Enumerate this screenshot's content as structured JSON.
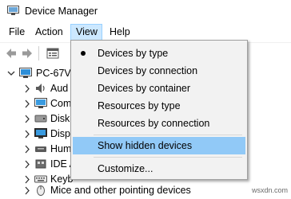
{
  "window": {
    "title": "Device Manager",
    "icon": "device-manager-icon"
  },
  "menubar": {
    "items": [
      {
        "label": "File"
      },
      {
        "label": "Action"
      },
      {
        "label": "View"
      },
      {
        "label": "Help"
      }
    ],
    "active": "View"
  },
  "toolbar": {
    "buttons": [
      "back-arrow-icon",
      "forward-arrow-icon",
      "properties-icon"
    ]
  },
  "tree": {
    "root": "PC-67Vi",
    "children": [
      {
        "label": "Aud",
        "icon": "audio-icon"
      },
      {
        "label": "Com",
        "icon": "computer-icon"
      },
      {
        "label": "Disk",
        "icon": "disk-drive-icon"
      },
      {
        "label": "Disp",
        "icon": "display-adapter-icon"
      },
      {
        "label": "Hum",
        "icon": "human-interface-icon"
      },
      {
        "label": "IDE A",
        "icon": "ide-controller-icon"
      },
      {
        "label": "Keyb",
        "icon": "keyboard-icon"
      },
      {
        "label": "Mice and other pointing devices",
        "icon": "mouse-icon"
      }
    ]
  },
  "view_menu": {
    "items": [
      {
        "label": "Devices by type",
        "checked": true
      },
      {
        "label": "Devices by connection",
        "checked": false
      },
      {
        "label": "Devices by container",
        "checked": false
      },
      {
        "label": "Resources by type",
        "checked": false
      },
      {
        "label": "Resources by connection",
        "checked": false
      },
      {
        "label": "Show hidden devices",
        "checked": false,
        "highlighted": true
      },
      {
        "label": "Customize...",
        "checked": false
      }
    ]
  },
  "watermark": "wsxdn.com",
  "colors": {
    "highlight": "#91c9f7",
    "menu_active": "#cce8ff",
    "menu_bg": "#f2f2f2"
  }
}
